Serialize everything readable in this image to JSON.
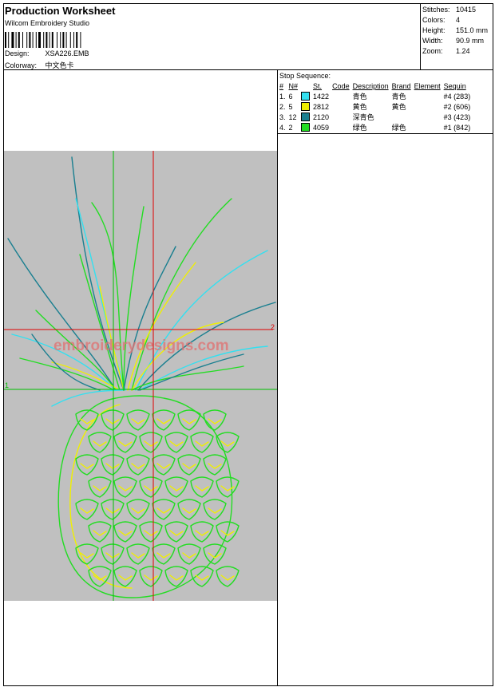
{
  "header": {
    "title": "Production Worksheet",
    "software": "Wilcom Embroidery Studio",
    "design_label": "Design:",
    "design_value": "XSA226.EMB",
    "colorway_label": "Colorway:",
    "colorway_value": "中文色卡"
  },
  "stats": [
    {
      "label": "Stitches:",
      "value": "10415"
    },
    {
      "label": "Colors:",
      "value": "4"
    },
    {
      "label": "Height:",
      "value": "151.0 mm"
    },
    {
      "label": "Width:",
      "value": "90.9 mm"
    },
    {
      "label": "Zoom:",
      "value": "1.24"
    }
  ],
  "stop_sequence": {
    "caption": "Stop Sequence:",
    "columns": [
      "#",
      "N#",
      "St.",
      "Code",
      "Description",
      "Brand",
      "Element",
      "Sequin"
    ],
    "rows": [
      {
        "num": "1.",
        "n": "6",
        "color": "#33e0f0",
        "st": "1422",
        "code": "",
        "description": "青色",
        "brand": "青色",
        "element": "",
        "sequin": "#4 (283)"
      },
      {
        "num": "2.",
        "n": "5",
        "color": "#f0f000",
        "st": "2812",
        "code": "",
        "description": "黄色",
        "brand": "黄色",
        "element": "",
        "sequin": "#2 (606)"
      },
      {
        "num": "3.",
        "n": "12",
        "color": "#1a7f90",
        "st": "2120",
        "code": "",
        "description": "深青色",
        "brand": "",
        "element": "",
        "sequin": "#3 (423)"
      },
      {
        "num": "4.",
        "n": "2",
        "color": "#22dd22",
        "st": "4059",
        "code": "",
        "description": "绿色",
        "brand": "绿色",
        "element": "",
        "sequin": "#1 (842)"
      }
    ]
  },
  "preview": {
    "watermark": "embroiderydesigns.com",
    "marker_1": "1",
    "marker_2": "2",
    "colors": {
      "background": "#c0c0c0",
      "crosshair_red": "#e00000",
      "crosshair_green": "#00c000",
      "cyan": "#33e0f0",
      "yellow": "#f0f000",
      "teal": "#1a7f90",
      "green": "#22dd22",
      "watermark": "#e07070"
    }
  }
}
